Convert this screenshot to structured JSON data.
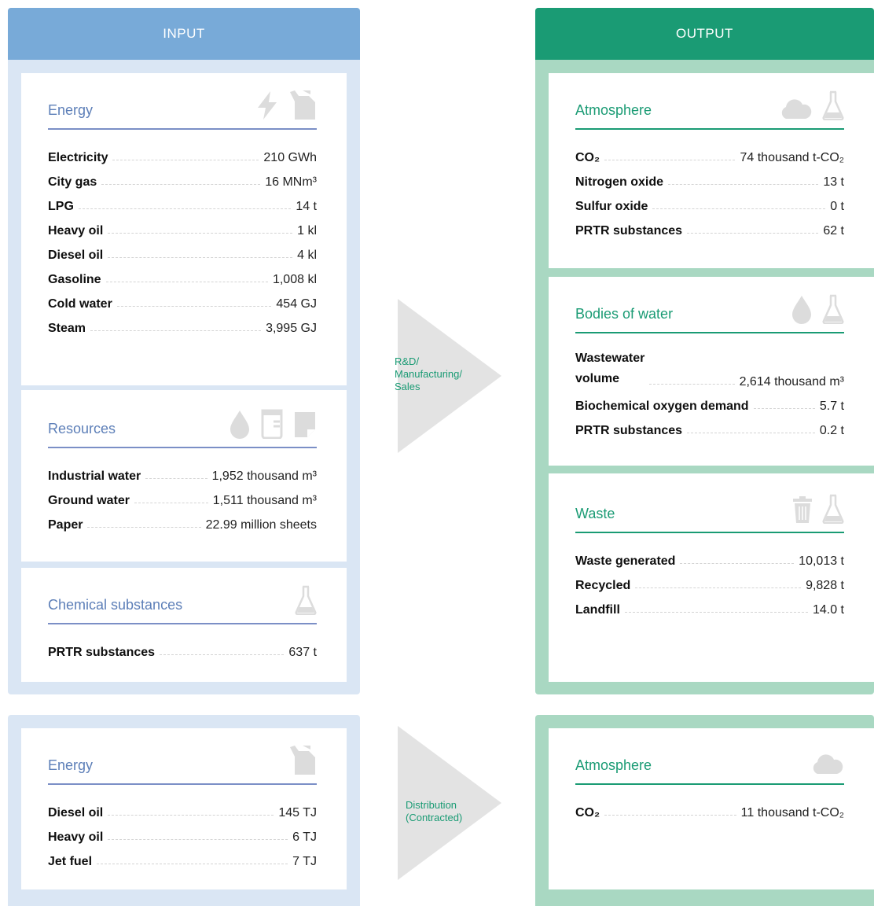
{
  "headers": {
    "input": "INPUT",
    "output": "OUTPUT"
  },
  "process": {
    "rd": [
      "R&D/",
      "Manufacturing/",
      "Sales"
    ],
    "distribution": [
      "Distribution",
      "(Contracted)"
    ]
  },
  "input_energy": {
    "title": "Energy",
    "icons": [
      "lightning-icon",
      "fuel-can-icon"
    ],
    "rows": [
      {
        "label": "Electricity",
        "value": "210 GWh"
      },
      {
        "label": "City gas",
        "value": "16 MNm³"
      },
      {
        "label": "LPG",
        "value": "14 t"
      },
      {
        "label": "Heavy oil",
        "value": "1 kl"
      },
      {
        "label": "Diesel oil",
        "value": "4 kl"
      },
      {
        "label": "Gasoline",
        "value": "1,008 kl"
      },
      {
        "label": "Cold water",
        "value": "454 GJ"
      },
      {
        "label": "Steam",
        "value": "3,995 GJ"
      }
    ]
  },
  "input_resources": {
    "title": "Resources",
    "icons": [
      "water-drop-icon",
      "beaker-icon",
      "paper-icon"
    ],
    "rows": [
      {
        "label": "Industrial water",
        "value": "1,952 thousand m³"
      },
      {
        "label": "Ground water",
        "value": "1,511 thousand m³"
      },
      {
        "label": "Paper",
        "value": "22.99 million sheets"
      }
    ]
  },
  "input_chemical": {
    "title": "Chemical substances",
    "icons": [
      "flask-icon"
    ],
    "rows": [
      {
        "label": "PRTR substances",
        "value": "637 t"
      }
    ]
  },
  "output_atmosphere": {
    "title": "Atmosphere",
    "icons": [
      "cloud-icon",
      "flask-icon"
    ],
    "rows": [
      {
        "label": "CO₂",
        "value": "74 thousand t-CO₂"
      },
      {
        "label": "Nitrogen oxide",
        "value": "13 t"
      },
      {
        "label": "Sulfur oxide",
        "value": "0 t"
      },
      {
        "label": "PRTR substances",
        "value": "62 t"
      }
    ]
  },
  "output_water": {
    "title": "Bodies of water",
    "icons": [
      "water-drop-icon",
      "flask-icon"
    ],
    "rows": [
      {
        "label_line1": "Wastewater",
        "label_line2": "volume",
        "value": "2,614 thousand m³"
      },
      {
        "label": "Biochemical oxygen demand",
        "value": "5.7 t"
      },
      {
        "label": "PRTR substances",
        "value": "0.2 t"
      }
    ]
  },
  "output_waste": {
    "title": "Waste",
    "icons": [
      "trash-icon",
      "flask-icon"
    ],
    "rows": [
      {
        "label": "Waste generated",
        "value": "10,013 t"
      },
      {
        "label": "Recycled",
        "value": "9,828 t"
      },
      {
        "label": "Landfill",
        "value": "14.0 t"
      }
    ]
  },
  "dist_input_energy": {
    "title": "Energy",
    "icons": [
      "fuel-can-icon"
    ],
    "rows": [
      {
        "label": "Diesel oil",
        "value": "145 TJ"
      },
      {
        "label": "Heavy oil",
        "value": "6 TJ"
      },
      {
        "label": "Jet fuel",
        "value": "7 TJ"
      }
    ]
  },
  "dist_output_atmosphere": {
    "title": "Atmosphere",
    "icons": [
      "cloud-icon"
    ],
    "rows": [
      {
        "label": "CO₂",
        "value": "11 thousand t-CO₂"
      }
    ]
  }
}
